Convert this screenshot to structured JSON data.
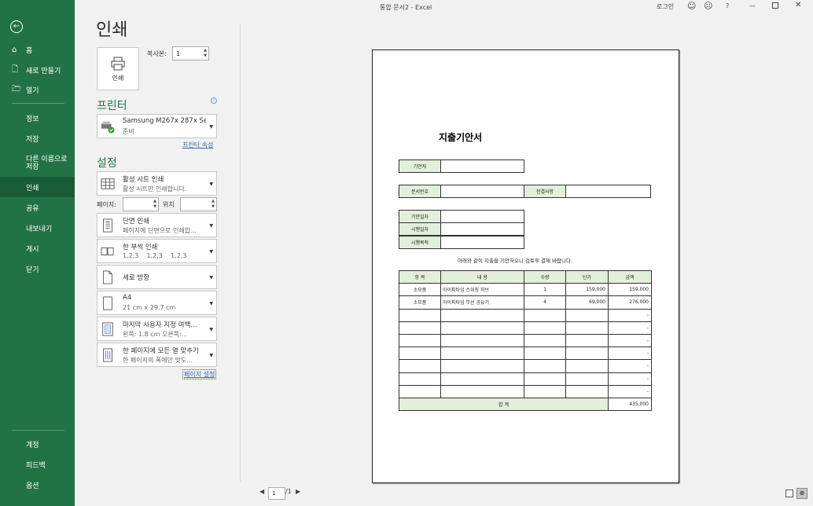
{
  "window": {
    "title": "통합 문서2  -  Excel",
    "login": "로그인",
    "help": "?"
  },
  "sidebar": {
    "items": [
      {
        "label": "홈",
        "icon": "home-icon"
      },
      {
        "label": "새로 만들기",
        "icon": "new-doc-icon"
      },
      {
        "label": "열기",
        "icon": "folder-open-icon"
      }
    ],
    "sub": [
      "정보",
      "저장",
      "다른 이름으로\n저장",
      "인쇄",
      "공유",
      "내보내기",
      "게시",
      "닫기"
    ],
    "bottom": [
      "계정",
      "피드백",
      "옵션"
    ],
    "active": "인쇄"
  },
  "print": {
    "heading": "인쇄",
    "print_button": "인쇄",
    "copies_label": "복사본:",
    "copies": "1",
    "printer_section": "프린터",
    "printer_name": "Samsung M267x 287x Se...",
    "printer_status": "준비",
    "printer_props": "프린터 속성",
    "settings_section": "설정",
    "settings": [
      {
        "l1": "활성 시트 인쇄",
        "l2": "활성 시트만 인쇄합니다.",
        "icon": "sheet-grid-icon"
      },
      {
        "l1": "단면 인쇄",
        "l2": "페이지에 단면으로 인쇄합...",
        "icon": "single-side-icon"
      },
      {
        "l1": "한 부씩 인쇄",
        "l2": "1,2,3    1,2,3    1,2,3",
        "icon": "collate-icon"
      },
      {
        "l1": "세로 방향",
        "l2": "",
        "icon": "portrait-icon"
      },
      {
        "l1": "A4",
        "l2": "21 cm x 29.7 cm",
        "icon": "paper-size-icon"
      },
      {
        "l1": "마지막 사용자 지정 여백...",
        "l2": "왼쪽:  1.8 cm    오른쪽:...",
        "icon": "margins-icon"
      },
      {
        "l1": "한 페이지에 모든 열 맞추기",
        "l2": "한 페이지의 폭에만 맞도...",
        "icon": "fit-columns-icon"
      }
    ],
    "pages_label": "페이지:",
    "to_label": "위치",
    "page_setup": "페이지 설정"
  },
  "preview": {
    "title": "지출기안서",
    "drafter_label": "기안자",
    "docno_label": "문서번호",
    "link_label": "전결사항",
    "date1": "기안일자",
    "date2": "시행일자",
    "purpose": "시행목적",
    "note": "아래와 같이 지출을 기안하오니 검토후 결재 바랍니다.",
    "headers": [
      "항 목",
      "내 용",
      "수량",
      "단가",
      "금액"
    ],
    "rows": [
      [
        "소모품",
        "아이피타임 스위칭 허브",
        "1",
        "159,000",
        "159,000"
      ],
      [
        "소모품",
        "아이피타임 무선 공유기",
        "4",
        "69,000",
        "276,000"
      ],
      [
        "",
        "",
        "",
        "",
        "-"
      ],
      [
        "",
        "",
        "",
        "",
        "-"
      ],
      [
        "",
        "",
        "",
        "",
        "-"
      ],
      [
        "",
        "",
        "",
        "",
        "-"
      ],
      [
        "",
        "",
        "",
        "",
        "-"
      ],
      [
        "",
        "",
        "",
        "",
        "-"
      ],
      [
        "",
        "",
        "",
        "",
        "-"
      ]
    ],
    "total_label": "합 계",
    "total": "435,000"
  },
  "pager": {
    "current": "1",
    "total": "/1"
  }
}
